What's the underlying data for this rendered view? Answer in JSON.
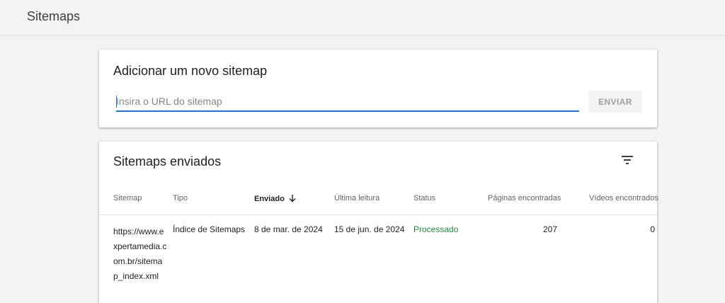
{
  "header": {
    "title": "Sitemaps"
  },
  "add_sitemap": {
    "title": "Adicionar um novo sitemap",
    "url_placeholder": "Insira o URL do sitemap",
    "url_value": "",
    "submit_label": "ENVIAR"
  },
  "submitted": {
    "title": "Sitemaps enviados",
    "columns": {
      "sitemap": "Sitemap",
      "type": "Tipo",
      "submitted": "Enviado",
      "last_read": "Última leitura",
      "status": "Status",
      "pages_found": "Páginas encontradas",
      "videos_found": "Vídeos encontrados"
    },
    "rows": [
      {
        "sitemap": "https://www.expertamedia.com.br/sitemap_index.xml",
        "type": "Índice de Sitemaps",
        "submitted": "8 de mar. de 2024",
        "last_read": "15 de jun. de 2024",
        "status": "Processado",
        "pages_found": "207",
        "videos_found": "0"
      }
    ]
  },
  "colors": {
    "background": "#f1f3f4",
    "accent": "#1a73e8",
    "status_success": "#1e8e3e"
  },
  "icons": {
    "filter": "filter-list-icon",
    "sort": "arrow-downward-icon"
  }
}
